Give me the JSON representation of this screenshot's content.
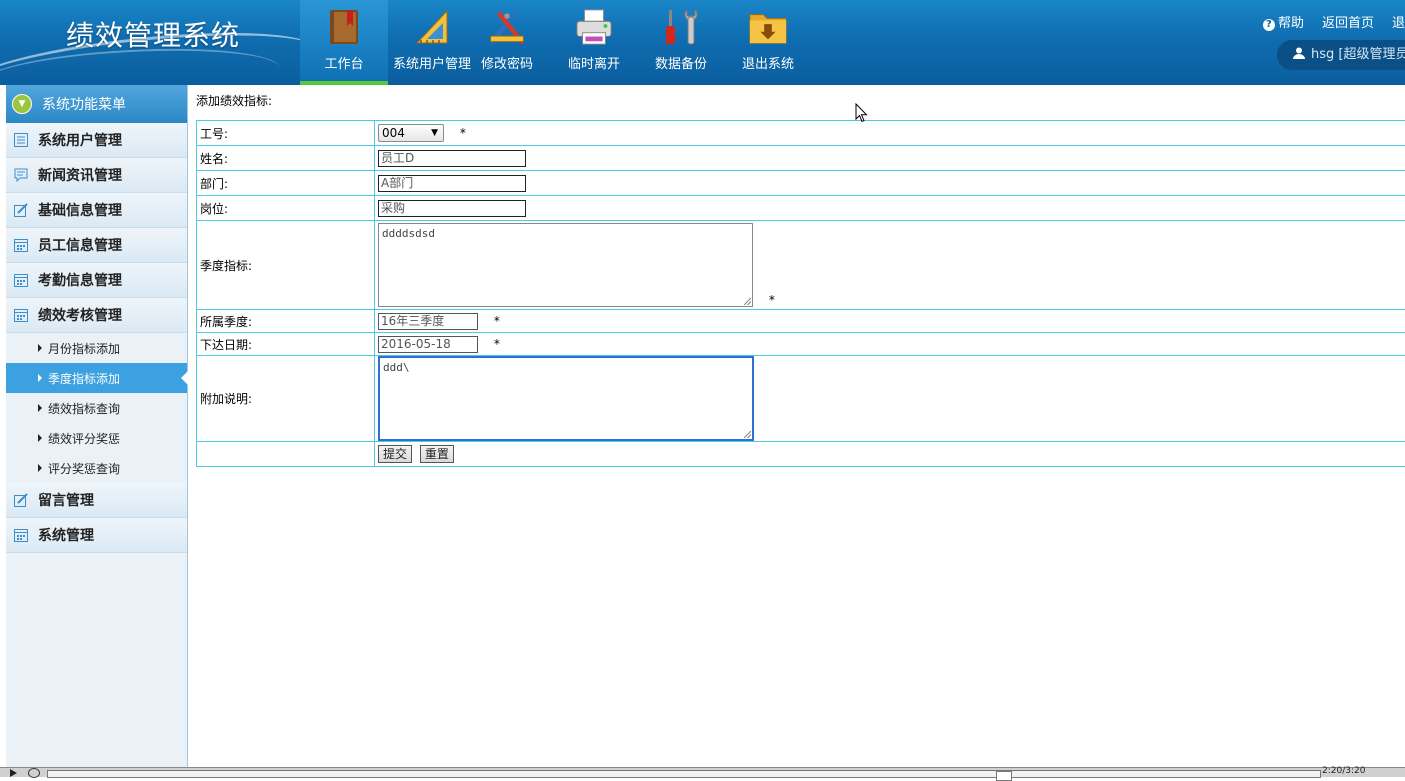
{
  "header": {
    "title": "绩效管理系统",
    "nav": [
      {
        "label": "工作台",
        "icon": "book-icon",
        "active": true
      },
      {
        "label": "系统用户管理",
        "icon": "ruler-icon",
        "active": false
      },
      {
        "label": "修改密码",
        "icon": "tools-icon",
        "active": false
      },
      {
        "label": "临时离开",
        "icon": "printer-icon",
        "active": false
      },
      {
        "label": "数据备份",
        "icon": "wrench-icon",
        "active": false
      },
      {
        "label": "退出系统",
        "icon": "folder-icon",
        "active": false
      }
    ],
    "links": {
      "help": "帮助",
      "home": "返回首页",
      "logout": "退"
    },
    "user": "hsg [超级管理员]"
  },
  "sidebar": {
    "header": "系统功能菜单",
    "items": [
      {
        "label": "系统用户管理"
      },
      {
        "label": "新闻资讯管理"
      },
      {
        "label": "基础信息管理"
      },
      {
        "label": "员工信息管理"
      },
      {
        "label": "考勤信息管理"
      },
      {
        "label": "绩效考核管理"
      }
    ],
    "subitems": [
      {
        "label": "月份指标添加"
      },
      {
        "label": "季度指标添加",
        "active": true
      },
      {
        "label": "绩效指标查询"
      },
      {
        "label": "绩效评分奖惩"
      },
      {
        "label": "评分奖惩查询"
      }
    ],
    "items_after": [
      {
        "label": "留言管理"
      },
      {
        "label": "系统管理"
      }
    ]
  },
  "form": {
    "title": "添加绩效指标:",
    "employee_id_label": "工号:",
    "employee_id_value": "004",
    "name_label": "姓名:",
    "name_value": "员工D",
    "dept_label": "部门:",
    "dept_value": "A部门",
    "post_label": "岗位:",
    "post_value": "采购",
    "quarter_target_label": "季度指标:",
    "quarter_target_value": "ddddsdsd",
    "quarter_label": "所属季度:",
    "quarter_value": "16年三季度",
    "issue_date_label": "下达日期:",
    "issue_date_value": "2016-05-18",
    "note_label": "附加说明:",
    "note_value": "ddd\\",
    "required_mark": "*",
    "submit": "提交",
    "reset": "重置"
  },
  "player": {
    "time": "2:20/3:20"
  },
  "colors": {
    "header": "#0f6db0",
    "accent": "#3ba1e0",
    "border": "#4cc9e4",
    "active_nav": "#5ac43a"
  }
}
